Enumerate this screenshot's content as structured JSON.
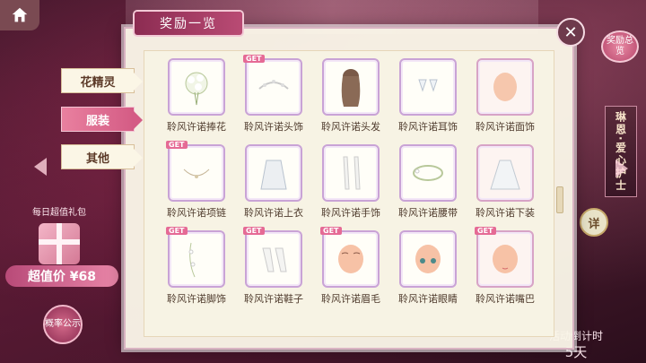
{
  "dialog": {
    "title": "奖励一览",
    "close_icon": "close-x-icon"
  },
  "tabs": [
    {
      "label": "花精灵",
      "active": false
    },
    {
      "label": "服装",
      "active": true
    },
    {
      "label": "其他",
      "active": false
    }
  ],
  "items": [
    {
      "label": "聆风许诺捧花",
      "get": false,
      "icon": "bouquet-icon"
    },
    {
      "label": "聆风许诺头饰",
      "get": true,
      "icon": "headpiece-icon"
    },
    {
      "label": "聆风许诺头发",
      "get": false,
      "icon": "hair-icon"
    },
    {
      "label": "聆风许诺耳饰",
      "get": false,
      "icon": "earring-icon"
    },
    {
      "label": "聆风许诺面饰",
      "get": false,
      "icon": "face-ornament-icon"
    },
    {
      "label": "聆风许诺项链",
      "get": true,
      "icon": "necklace-icon"
    },
    {
      "label": "聆风许诺上衣",
      "get": false,
      "icon": "top-icon"
    },
    {
      "label": "聆风许诺手饰",
      "get": false,
      "icon": "gloves-icon"
    },
    {
      "label": "聆风许诺腰带",
      "get": false,
      "icon": "belt-icon"
    },
    {
      "label": "聆风许诺下装",
      "get": false,
      "icon": "skirt-icon"
    },
    {
      "label": "聆风许诺脚饰",
      "get": true,
      "icon": "anklet-icon"
    },
    {
      "label": "聆风许诺鞋子",
      "get": true,
      "icon": "shoes-icon"
    },
    {
      "label": "聆风许诺眉毛",
      "get": true,
      "icon": "eyebrows-icon"
    },
    {
      "label": "聆风许诺眼睛",
      "get": false,
      "icon": "eyes-icon"
    },
    {
      "label": "聆风许诺嘴巴",
      "get": true,
      "icon": "mouth-icon"
    }
  ],
  "get_badge_text": "GET",
  "background": {
    "reward_overview_label": "奖励总览",
    "side_banner": "琳恩·爱心护士",
    "detail_label": "详",
    "daily_gift": "每日超值礼包",
    "price_label": "超值价 ¥68",
    "lottery_label": "概率公示",
    "countdown_label": "活动倒计时",
    "countdown_value": "5天"
  },
  "colors": {
    "accent_pink": "#d45c85",
    "title_bar": "#8c2c52",
    "panel_bg": "#f7f3e4",
    "frame_border": "#c9a3d6"
  }
}
